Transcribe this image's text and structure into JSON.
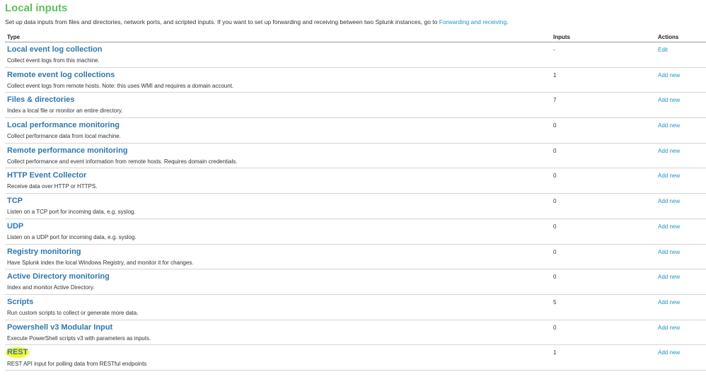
{
  "header": {
    "title": "Local inputs",
    "description": "Set up data inputs from files and directories, network ports, and scripted inputs. If you want to set up forwarding and receiving between two Splunk instances, go to",
    "link_text": "Forwarding and receiving",
    "link_suffix": "."
  },
  "table": {
    "columns": [
      "Type",
      "Inputs",
      "Actions"
    ],
    "rows": [
      {
        "title": "Local event log collection",
        "description": "Collect event logs from this machine.",
        "inputs": "-",
        "action": "Edit"
      },
      {
        "title": "Remote event log collections",
        "description": "Collect event logs from remote hosts. Note: this uses WMI and requires a domain account.",
        "inputs": "1",
        "action": "Add new"
      },
      {
        "title": "Files & directories",
        "description": "Index a local file or monitor an entire directory.",
        "inputs": "7",
        "action": "Add new"
      },
      {
        "title": "Local performance monitoring",
        "description": "Collect performance data from local machine.",
        "inputs": "0",
        "action": "Add new"
      },
      {
        "title": "Remote performance monitoring",
        "description": "Collect performance and event information from remote hosts. Requires domain credentials.",
        "inputs": "0",
        "action": "Add new"
      },
      {
        "title": "HTTP Event Collector",
        "description": "Receive data over HTTP or HTTPS.",
        "inputs": "0",
        "action": "Add new"
      },
      {
        "title": "TCP",
        "description": "Listen on a TCP port for incoming data, e.g. syslog.",
        "inputs": "0",
        "action": "Add new"
      },
      {
        "title": "UDP",
        "description": "Listen on a UDP port for incoming data, e.g. syslog.",
        "inputs": "0",
        "action": "Add new"
      },
      {
        "title": "Registry monitoring",
        "description": "Have Splunk index the local Windows Registry, and monitor it for changes.",
        "inputs": "0",
        "action": "Add new"
      },
      {
        "title": "Active Directory monitoring",
        "description": "Index and monitor Active Directory.",
        "inputs": "0",
        "action": "Add new"
      },
      {
        "title": "Scripts",
        "description": "Run custom scripts to collect or generate more data.",
        "inputs": "5",
        "action": "Add new"
      },
      {
        "title": "Powershell v3 Modular Input",
        "description": "Execute PowerShell scripts v3 with parameters as inputs.",
        "inputs": "0",
        "action": "Add new"
      },
      {
        "title": "REST",
        "description": "REST API input for polling data from RESTful endpoints",
        "inputs": "1",
        "action": "Add new"
      }
    ]
  },
  "colors": {
    "title_green": "#5cc05c",
    "link_blue": "#1e93c6",
    "row_title_blue": "#2f77ad",
    "highlight_yellow": "#f4f42a"
  }
}
